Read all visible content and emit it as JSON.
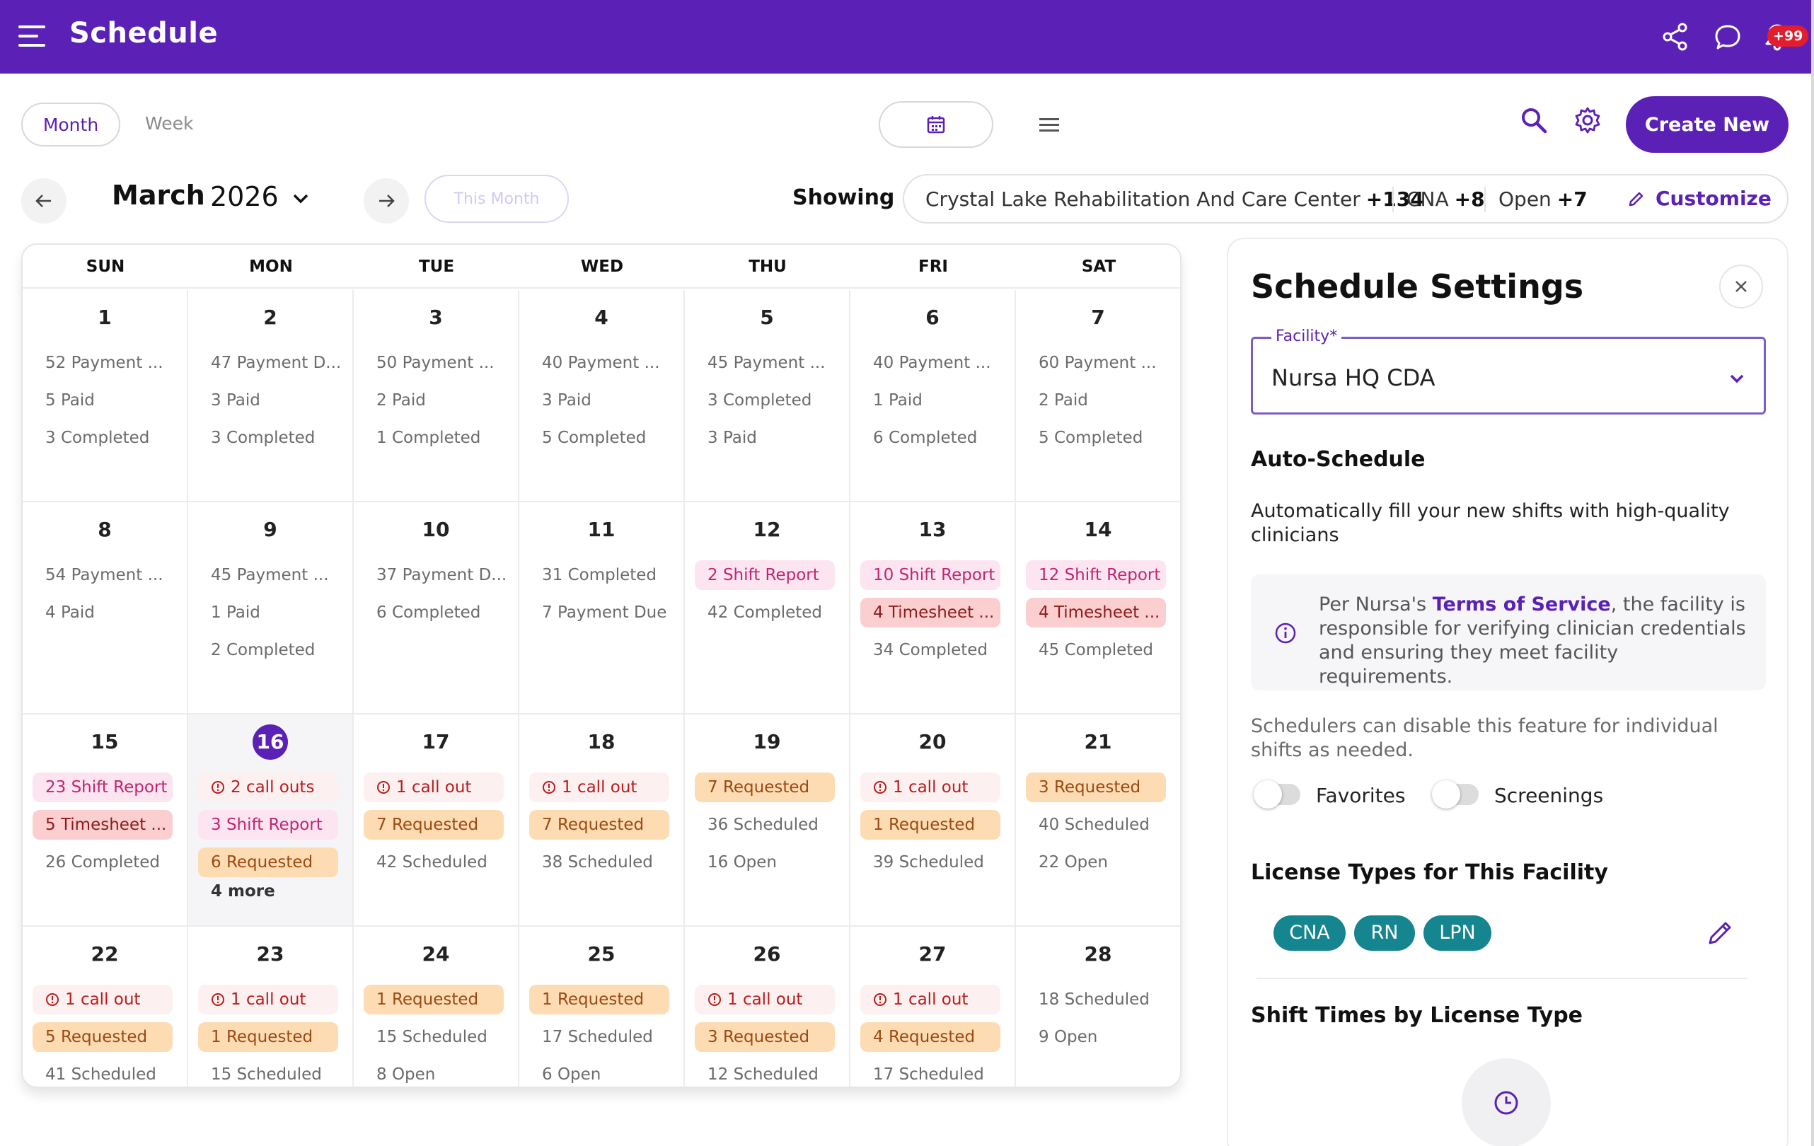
{
  "header": {
    "title": "Schedule",
    "notification_count": "+99",
    "icons": [
      "menu-icon",
      "share-icon",
      "chat-icon",
      "bell-icon"
    ]
  },
  "toolbar": {
    "view_month": "Month",
    "view_week": "Week",
    "create_new": "Create New",
    "icons": [
      "calendar-icon",
      "list-icon",
      "search-icon",
      "gear-icon"
    ]
  },
  "month_nav": {
    "month": "March",
    "year": "2026",
    "this_month": "This Month",
    "icons": [
      "arrow-left-icon",
      "arrow-right-icon",
      "chevron-down-icon"
    ]
  },
  "filters": {
    "showing_label": "Showing",
    "facility": "Crystal Lake Rehabilitation And Care Center",
    "facility_count": "+134",
    "license": "CNA",
    "license_count": "+8",
    "status": "Open",
    "status_count": "+7",
    "customize": "Customize"
  },
  "calendar": {
    "weekdays": [
      "SUN",
      "MON",
      "TUE",
      "WED",
      "THU",
      "FRI",
      "SAT"
    ],
    "today": "16",
    "days": [
      {
        "day": "1",
        "items": [
          {
            "text": "52 Payment ..."
          },
          {
            "text": "5 Paid"
          },
          {
            "text": "3 Completed"
          }
        ]
      },
      {
        "day": "2",
        "items": [
          {
            "text": "47 Payment D..."
          },
          {
            "text": "3 Paid"
          },
          {
            "text": "3 Completed"
          }
        ]
      },
      {
        "day": "3",
        "items": [
          {
            "text": "50 Payment ..."
          },
          {
            "text": "2 Paid"
          },
          {
            "text": "1 Completed"
          }
        ]
      },
      {
        "day": "4",
        "items": [
          {
            "text": "40 Payment ..."
          },
          {
            "text": "3 Paid"
          },
          {
            "text": "5 Completed"
          }
        ]
      },
      {
        "day": "5",
        "items": [
          {
            "text": "45 Payment ..."
          },
          {
            "text": "3 Completed"
          },
          {
            "text": "3 Paid"
          }
        ]
      },
      {
        "day": "6",
        "items": [
          {
            "text": "40 Payment ..."
          },
          {
            "text": "1 Paid"
          },
          {
            "text": "6 Completed"
          }
        ]
      },
      {
        "day": "7",
        "items": [
          {
            "text": "60 Payment ..."
          },
          {
            "text": "2 Paid"
          },
          {
            "text": "5 Completed"
          }
        ]
      },
      {
        "day": "8",
        "items": [
          {
            "text": "54 Payment ..."
          },
          {
            "text": "4 Paid"
          }
        ]
      },
      {
        "day": "9",
        "items": [
          {
            "text": "45 Payment ..."
          },
          {
            "text": "1 Paid"
          },
          {
            "text": "2 Completed"
          }
        ]
      },
      {
        "day": "10",
        "items": [
          {
            "text": "37 Payment D..."
          },
          {
            "text": "6 Completed"
          }
        ]
      },
      {
        "day": "11",
        "items": [
          {
            "text": "31 Completed"
          },
          {
            "text": "7 Payment Due"
          }
        ]
      },
      {
        "day": "12",
        "items": [
          {
            "text": "2 Shift Report",
            "style": "pink"
          },
          {
            "text": "42 Completed"
          }
        ]
      },
      {
        "day": "13",
        "items": [
          {
            "text": "10 Shift Report",
            "style": "pink"
          },
          {
            "text": "4 Timesheet ...",
            "style": "red"
          },
          {
            "text": "34 Completed"
          }
        ]
      },
      {
        "day": "14",
        "items": [
          {
            "text": "12 Shift Report",
            "style": "pink"
          },
          {
            "text": "4 Timesheet ...",
            "style": "red"
          },
          {
            "text": "45 Completed"
          }
        ]
      },
      {
        "day": "15",
        "items": [
          {
            "text": "23 Shift Report",
            "style": "pink"
          },
          {
            "text": "5 Timesheet ...",
            "style": "red"
          },
          {
            "text": "26 Completed"
          }
        ]
      },
      {
        "day": "16",
        "items": [
          {
            "text": "2 call outs",
            "style": "callout"
          },
          {
            "text": "3 Shift Report",
            "style": "pink"
          },
          {
            "text": "6 Requested",
            "style": "orange"
          }
        ],
        "more": "4 more"
      },
      {
        "day": "17",
        "items": [
          {
            "text": "1 call out",
            "style": "callout"
          },
          {
            "text": "7 Requested",
            "style": "orange"
          },
          {
            "text": "42 Scheduled"
          }
        ]
      },
      {
        "day": "18",
        "items": [
          {
            "text": "1 call out",
            "style": "callout"
          },
          {
            "text": "7 Requested",
            "style": "orange"
          },
          {
            "text": "38 Scheduled"
          }
        ]
      },
      {
        "day": "19",
        "items": [
          {
            "text": "7 Requested",
            "style": "orange"
          },
          {
            "text": "36 Scheduled"
          },
          {
            "text": "16 Open"
          }
        ]
      },
      {
        "day": "20",
        "items": [
          {
            "text": "1 call out",
            "style": "callout"
          },
          {
            "text": "1 Requested",
            "style": "orange"
          },
          {
            "text": "39 Scheduled"
          }
        ]
      },
      {
        "day": "21",
        "items": [
          {
            "text": "3 Requested",
            "style": "orange"
          },
          {
            "text": "40 Scheduled"
          },
          {
            "text": "22 Open"
          }
        ]
      },
      {
        "day": "22",
        "items": [
          {
            "text": "1 call out",
            "style": "callout"
          },
          {
            "text": "5 Requested",
            "style": "orange"
          },
          {
            "text": "41 Scheduled"
          }
        ]
      },
      {
        "day": "23",
        "items": [
          {
            "text": "1 call out",
            "style": "callout"
          },
          {
            "text": "1 Requested",
            "style": "orange"
          },
          {
            "text": "15 Scheduled"
          }
        ]
      },
      {
        "day": "24",
        "items": [
          {
            "text": "1 Requested",
            "style": "orange"
          },
          {
            "text": "15 Scheduled"
          },
          {
            "text": "8 Open"
          }
        ]
      },
      {
        "day": "25",
        "items": [
          {
            "text": "1 Requested",
            "style": "orange"
          },
          {
            "text": "17 Scheduled"
          },
          {
            "text": "6 Open"
          }
        ]
      },
      {
        "day": "26",
        "items": [
          {
            "text": "1 call out",
            "style": "callout"
          },
          {
            "text": "3 Requested",
            "style": "orange"
          },
          {
            "text": "12 Scheduled"
          }
        ]
      },
      {
        "day": "27",
        "items": [
          {
            "text": "1 call out",
            "style": "callout"
          },
          {
            "text": "4 Requested",
            "style": "orange"
          },
          {
            "text": "17 Scheduled"
          }
        ]
      },
      {
        "day": "28",
        "items": [
          {
            "text": "18 Scheduled"
          },
          {
            "text": "9 Open"
          }
        ]
      }
    ]
  },
  "settings": {
    "title": "Schedule Settings",
    "facility_label": "Facility*",
    "facility_value": "Nursa HQ CDA",
    "auto_schedule_heading": "Auto-Schedule",
    "auto_schedule_desc": "Automatically fill your new shifts with high-quality clinicians",
    "info_prefix": "Per Nursa's ",
    "info_link": "Terms of Service",
    "info_suffix": ", the facility is responsible for verifying clinician credentials and ensuring they meet facility requirements.",
    "disable_note": "Schedulers can disable this feature for individual shifts as needed.",
    "toggle_favorites": "Favorites",
    "toggle_screenings": "Screenings",
    "license_heading": "License Types for This Facility",
    "license_types": [
      "CNA",
      "RN",
      "LPN"
    ],
    "shift_times_heading": "Shift Times by License Type"
  },
  "colors": {
    "brand": "#5b21b6",
    "chip_pink": "#fde4f1",
    "chip_red": "#fbcfcf",
    "chip_orange": "#fddcb4",
    "license_teal": "#15858f",
    "badge_red": "#e11d2e"
  }
}
